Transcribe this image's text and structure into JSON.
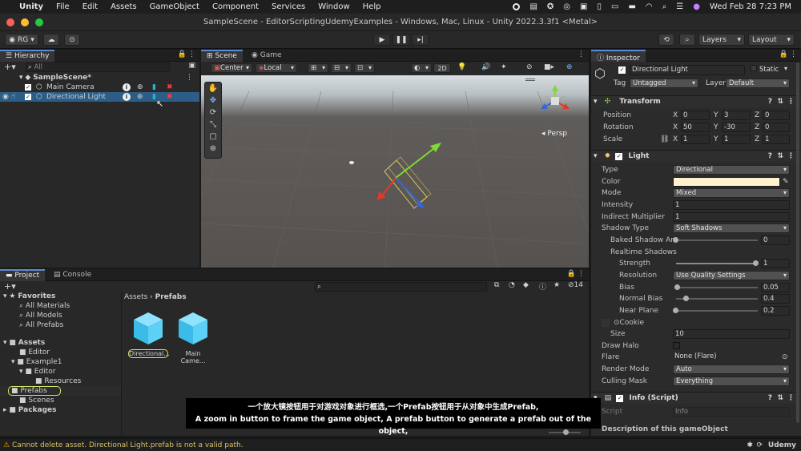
{
  "menubar": {
    "apple": "",
    "app": "Unity",
    "items": [
      "File",
      "Edit",
      "Assets",
      "GameObject",
      "Component",
      "Services",
      "Window",
      "Help"
    ],
    "datetime": "Wed Feb 28  7:23 PM"
  },
  "window": {
    "title": "SampleScene - EditorScriptingUdemyExamples - Windows, Mac, Linux - Unity 2022.3.3f1 <Metal>"
  },
  "toolbar": {
    "account": "RG",
    "layers": "Layers",
    "layout": "Layout"
  },
  "hierarchy": {
    "tab": "Hierarchy",
    "search_placeholder": "All",
    "scene": "SampleScene*",
    "items": [
      "Main Camera",
      "Directional Light"
    ]
  },
  "scene_view": {
    "tabs": [
      "Scene",
      "Game"
    ],
    "pivot": "Center",
    "space": "Local",
    "mode_2d": "2D",
    "persp": "Persp",
    "gizmo_axes": [
      "x",
      "y",
      "z"
    ]
  },
  "project": {
    "tabs": [
      "Project",
      "Console"
    ],
    "count": "14",
    "favorites": {
      "label": "Favorites",
      "items": [
        "All Materials",
        "All Models",
        "All Prefabs"
      ]
    },
    "assets": {
      "label": "Assets",
      "items": [
        "Editor",
        "Example1",
        "Editor",
        "Resources",
        "Prefabs",
        "Scenes"
      ]
    },
    "packages": "Packages",
    "breadcrumb": [
      "Assets",
      "Prefabs"
    ],
    "files": [
      "Directional...",
      "Main Came..."
    ]
  },
  "inspector": {
    "tab": "Inspector",
    "object_name": "Directional Light",
    "static_label": "Static",
    "tag_label": "Tag",
    "tag_value": "Untagged",
    "layer_label": "Layer",
    "layer_value": "Default",
    "transform": {
      "title": "Transform",
      "position": {
        "label": "Position",
        "x": "0",
        "y": "3",
        "z": "0"
      },
      "rotation": {
        "label": "Rotation",
        "x": "50",
        "y": "-30",
        "z": "0"
      },
      "scale": {
        "label": "Scale",
        "x": "1",
        "y": "1",
        "z": "1"
      }
    },
    "light": {
      "title": "Light",
      "rows": [
        {
          "label": "Type",
          "value": "Directional",
          "kind": "dd"
        },
        {
          "label": "Color",
          "value": "",
          "kind": "color"
        },
        {
          "label": "Mode",
          "value": "Mixed",
          "kind": "dd"
        },
        {
          "label": "Intensity",
          "value": "1",
          "kind": "field"
        },
        {
          "label": "Indirect Multiplier",
          "value": "1",
          "kind": "field"
        },
        {
          "label": "Shadow Type",
          "value": "Soft Shadows",
          "kind": "dd"
        }
      ],
      "baked_shadow": {
        "label": "Baked Shadow An",
        "value": "0"
      },
      "realtime_shadows": "Realtime Shadows",
      "strength": {
        "label": "Strength",
        "value": "1"
      },
      "resolution": {
        "label": "Resolution",
        "value": "Use Quality Settings"
      },
      "bias": {
        "label": "Bias",
        "value": "0.05"
      },
      "normal_bias": {
        "label": "Normal Bias",
        "value": "0.4"
      },
      "near_plane": {
        "label": "Near Plane",
        "value": "0.2"
      },
      "cookie": "Cookie",
      "size": {
        "label": "Size",
        "value": "10"
      },
      "draw_halo": "Draw Halo",
      "flare": {
        "label": "Flare",
        "value": "None (Flare)"
      },
      "render_mode": {
        "label": "Render Mode",
        "value": "Auto"
      },
      "culling_mask": {
        "label": "Culling Mask",
        "value": "Everything"
      }
    },
    "script": {
      "title": "Info (Script)",
      "label": "Script",
      "value": "Info"
    },
    "description": "Description of this gameObject"
  },
  "subtitles": {
    "zh": "一个放大镜按钮用于对游戏对象进行框选,一个Prefab按钮用于从对象中生成Prefab,",
    "en": "A zoom in button to frame the game object, A prefab button to generate a prefab out of the object,"
  },
  "status": {
    "message": "Cannot delete asset. Directional Light.prefab is not a valid path.",
    "watermark": "Udemy"
  },
  "colors": {
    "selection": "#2c5d87",
    "accent": "#5a8bd5",
    "light_color": "#fff2cc",
    "warning": "#e8b300"
  }
}
